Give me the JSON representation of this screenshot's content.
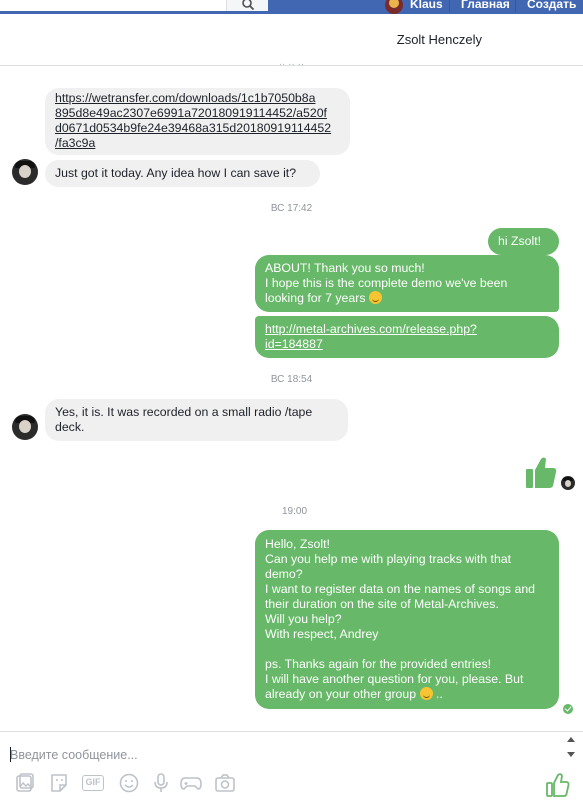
{
  "topbar": {
    "user_name": "Klaus",
    "home_label": "Главная",
    "create_label": "Создать"
  },
  "header": {
    "title": "Zsolt Henczely"
  },
  "messages": {
    "m1_link": "https://wetransfer.com/downloads/1c1b7050b8a895d8e49ac2307e6991a720180919114452/a520fd0671d0534b9fe24e39468a315d20180919114452/fa3c9a",
    "m1_lines": [
      "https://wetransfer.com/downloads/1c1b7050b8a",
      "895d8e49ac2307e6991a720180919114452/a520f",
      "d0671d0534b9fe24e39468a315d20180919114452",
      "/fa3c9a"
    ],
    "m2": "Just got it today.  Any idea how I can save it?",
    "ts1": "ВС 17:42",
    "m3": "hi  Zsolt!",
    "m4_line1": "ABOUT! Thank you so much!",
    "m4_line2": "I hope this is the complete demo we've been",
    "m4_line3": "looking for 7 years",
    "m5_line1": "http://metal-archives.com/release.php?",
    "m5_line2": "id=184887",
    "ts2": "ВС 18:54",
    "m6_line1": "Yes, it is. It was recorded on a small radio /tape",
    "m6_line2": "deck.",
    "ts3": "19:00",
    "m8_lines": [
      "Hello, Zsolt!",
      "Can you help me with playing tracks with that",
      "demo?",
      "I want to register data on the names of songs and",
      "their duration on the site of Metal-Archives.",
      "Will you help?",
      "With respect, Andrey",
      "",
      "ps. Thanks again for the provided entries!",
      "I will have another question for you, please. But",
      "already on your other group"
    ],
    "m8_tail": " .."
  },
  "composer": {
    "placeholder": "Введите сообщение..."
  },
  "icons": {
    "search": "search-icon",
    "thumbs_up": "thumbs-up-icon",
    "smile_emoji": "smiling-emoji-icon",
    "image": "image-icon",
    "sticker": "sticker-icon",
    "gif": "GIF",
    "emoji": "emoji-icon",
    "mic": "microphone-icon",
    "game": "gamepad-icon",
    "camera": "camera-icon",
    "like": "like-icon"
  },
  "colors": {
    "facebook_blue": "#4267b2",
    "outgoing_bubble": "#67b868",
    "incoming_bubble": "#f1f0f0",
    "timestamp": "#90949c"
  }
}
